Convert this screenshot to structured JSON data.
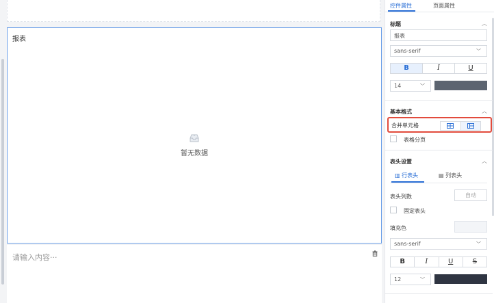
{
  "canvas": {
    "report_title": "报表",
    "empty_text": "暂无数据",
    "text_placeholder": "请输入内容···"
  },
  "panel": {
    "tabs": [
      "控件属性",
      "页面属性"
    ],
    "title_section": {
      "heading": "标题",
      "title_value": "报表",
      "font_family": "sans-serif",
      "style_buttons": [
        "B",
        "I",
        "U"
      ],
      "font_size": "14",
      "color": "#5c6470"
    },
    "basic_section": {
      "heading": "基本格式",
      "merge_label": "合并单元格",
      "paging_label": "表格分页"
    },
    "header_section": {
      "heading": "表头设置",
      "sub_tabs": [
        "行表头",
        "列表头"
      ],
      "col_count_label": "表头列数",
      "col_count_placeholder": "自动",
      "fixed_label": "固定表头",
      "fill_label": "填充色",
      "font_family": "sans-serif",
      "style_buttons": [
        "B",
        "I",
        "U",
        "S"
      ],
      "font_size": "12",
      "color": "#2f3542"
    },
    "accent_color": "#2a6fd6",
    "highlight_color": "#e24b3c"
  }
}
